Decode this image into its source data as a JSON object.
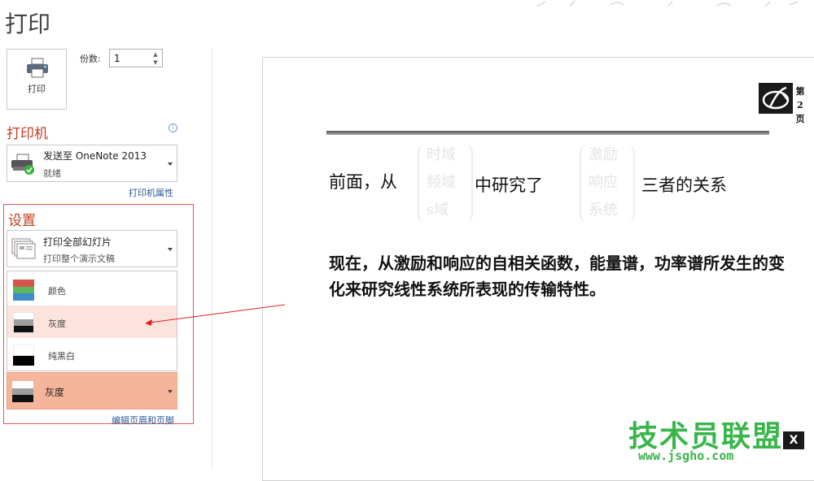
{
  "header": {
    "title": "打印"
  },
  "print_button": {
    "label": "打印",
    "icon": "printer-icon"
  },
  "copies": {
    "label": "份数:",
    "value": "1"
  },
  "printer": {
    "section_title": "打印机",
    "name": "发送至 OneNote 2013",
    "status": "就绪",
    "properties_link": "打印机属性"
  },
  "settings": {
    "section_title": "设置",
    "slides": {
      "title": "打印全部幻灯片",
      "subtitle": "打印整个演示文稿"
    },
    "color_options": [
      {
        "label": "颜色",
        "icon": "color-swatch-icon"
      },
      {
        "label": "灰度",
        "icon": "grayscale-swatch-icon"
      },
      {
        "label": "纯黑白",
        "icon": "black-white-swatch-icon"
      }
    ],
    "selected_color": "灰度",
    "edit_header_link": "编辑页眉和页脚"
  },
  "preview": {
    "page_label": "第2页",
    "line1_a": "前面，从",
    "brace1": [
      "时域",
      "频域",
      "s域"
    ],
    "line1_b": "中研究了",
    "brace2": [
      "激励",
      "响应",
      "系统"
    ],
    "line1_c": "三者的关系",
    "line2": "现在，从激励和响应的自相关函数，能量谱，功率谱所发生的变化来研究线性系统所表现的传输特性。"
  },
  "watermark": {
    "text": "技术员联盟",
    "url": "www.jsgho.com"
  },
  "colors": {
    "accent": "#c63c21",
    "selected_bg": "#f5b59b",
    "hover_bg": "#fce4dd",
    "link": "#2b5797"
  }
}
